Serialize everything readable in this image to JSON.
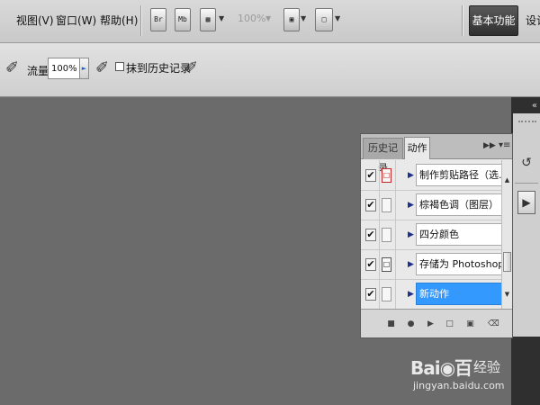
{
  "menu": {
    "items": [
      "视图(V)",
      "窗口(W)",
      "帮助(H)"
    ]
  },
  "toolbar": {
    "bridge_icon": "Br",
    "minibridge_icon": "Mb",
    "zoom": "100%",
    "workspace_label": "基本功能",
    "workspace_more": "设计"
  },
  "options": {
    "flow_label": "流量",
    "flow_value": "100%",
    "history_label": "抹到历史记录"
  },
  "actions_panel": {
    "tabs": {
      "history": "历史记录",
      "actions": "动作"
    },
    "rows": [
      {
        "label": "制作剪贴路径（选...",
        "check": "✔",
        "dialog": "□"
      },
      {
        "label": "棕褐色调（图层）",
        "check": "✔",
        "dialog": ""
      },
      {
        "label": "四分颜色",
        "check": "✔",
        "dialog": ""
      },
      {
        "label": "存储为 Photoshop P...",
        "check": "✔",
        "dialog": "□"
      },
      {
        "label": "新动作",
        "check": "✔",
        "dialog": ""
      }
    ]
  },
  "watermark": {
    "logo": "Bai◉百",
    "jingyan": "经验",
    "url": "jingyan.baidu.com"
  }
}
